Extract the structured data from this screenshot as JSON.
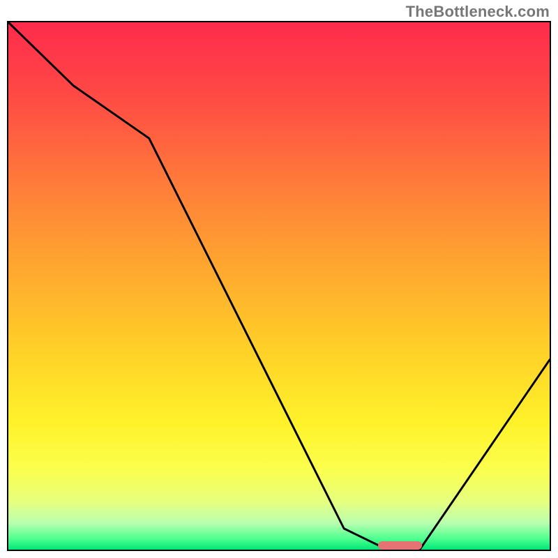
{
  "watermark": "TheBottleneck.com",
  "chart_data": {
    "type": "line",
    "title": "",
    "xlabel": "",
    "ylabel": "",
    "xlim": [
      0,
      100
    ],
    "ylim": [
      0,
      100
    ],
    "grid": false,
    "legend": false,
    "background_gradient": {
      "top_color": "#ff2b4c",
      "bottom_color": "#00e676",
      "description": "vertical red-to-green heat gradient"
    },
    "series": [
      {
        "name": "bottleneck-curve",
        "x": [
          0,
          12,
          26,
          62,
          70,
          76,
          100
        ],
        "values": [
          100,
          88,
          78,
          4,
          0,
          0,
          36
        ]
      }
    ],
    "annotations": [
      {
        "name": "optimal-marker",
        "shape": "rounded-bar",
        "color": "#e57373",
        "x_start": 68,
        "x_end": 76,
        "y": 0
      }
    ]
  }
}
